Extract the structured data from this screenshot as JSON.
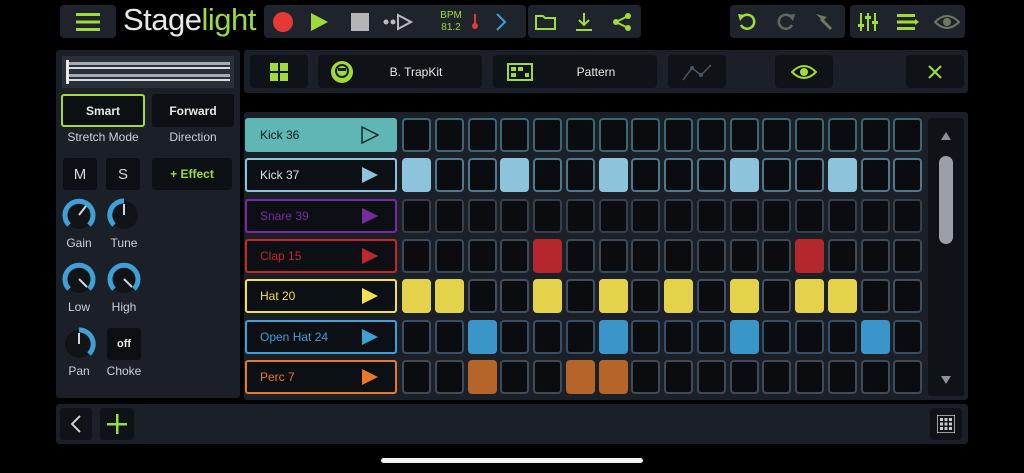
{
  "app": {
    "title_main": "Stage",
    "title_accent": "light"
  },
  "transport": {
    "bpm_label": "BPM",
    "bpm_value": "81.2"
  },
  "toolbar": {
    "kit_name": "B. TrapKit",
    "pattern_label": "Pattern"
  },
  "sample": {
    "stretch_mode": "Smart",
    "stretch_mode_label": "Stretch Mode",
    "direction": "Forward",
    "direction_label": "Direction"
  },
  "controls": {
    "mute": "M",
    "solo": "S",
    "effect": "+ Effect",
    "gain": "Gain",
    "tune": "Tune",
    "low": "Low",
    "high": "High",
    "pan": "Pan",
    "choke_value": "off",
    "choke": "Choke"
  },
  "tracks": [
    {
      "name": "Kick 36",
      "color": "#5fb6b4",
      "selected": true
    },
    {
      "name": "Kick 37",
      "color": "#8ec3dc",
      "selected": false
    },
    {
      "name": "Snare 39",
      "color": "#7a2aa0",
      "selected": false
    },
    {
      "name": "Clap 15",
      "color": "#c0282e",
      "selected": false
    },
    {
      "name": "Hat 20",
      "color": "#f2df52",
      "selected": false
    },
    {
      "name": "Open Hat 24",
      "color": "#3ea0d6",
      "selected": false
    },
    {
      "name": "Perc 7",
      "color": "#e8782c",
      "selected": false
    }
  ],
  "steps": [
    [
      0,
      0,
      0,
      0,
      0,
      0,
      0,
      0,
      0,
      0,
      0,
      0,
      0,
      0,
      0,
      0
    ],
    [
      1,
      0,
      0,
      1,
      0,
      0,
      1,
      0,
      0,
      0,
      1,
      0,
      0,
      1,
      0,
      0
    ],
    [
      0,
      0,
      0,
      0,
      0,
      0,
      0,
      0,
      0,
      0,
      0,
      0,
      0,
      0,
      0,
      0
    ],
    [
      0,
      0,
      0,
      0,
      1,
      0,
      0,
      0,
      0,
      0,
      0,
      0,
      1,
      0,
      0,
      0
    ],
    [
      1,
      1,
      0,
      0,
      1,
      0,
      1,
      0,
      1,
      0,
      1,
      0,
      1,
      1,
      0,
      0
    ],
    [
      0,
      0,
      1,
      0,
      0,
      0,
      1,
      0,
      0,
      0,
      1,
      0,
      0,
      0,
      1,
      0
    ],
    [
      0,
      0,
      1,
      0,
      0,
      1,
      1,
      0,
      0,
      0,
      0,
      0,
      0,
      0,
      0,
      0
    ]
  ],
  "step_fill_colors": [
    "#5fb6b4",
    "#8ec3dc",
    "#7a2aa0",
    "#b3272d",
    "#e3d24a",
    "#3a95c9",
    "#b5642a"
  ],
  "step_border_colors": [
    "#3d6672",
    "#50788a",
    "#36404c",
    "#3b4a55",
    "#405060",
    "#36506a",
    "#3f4c58"
  ],
  "accent": "#9fdc3a"
}
